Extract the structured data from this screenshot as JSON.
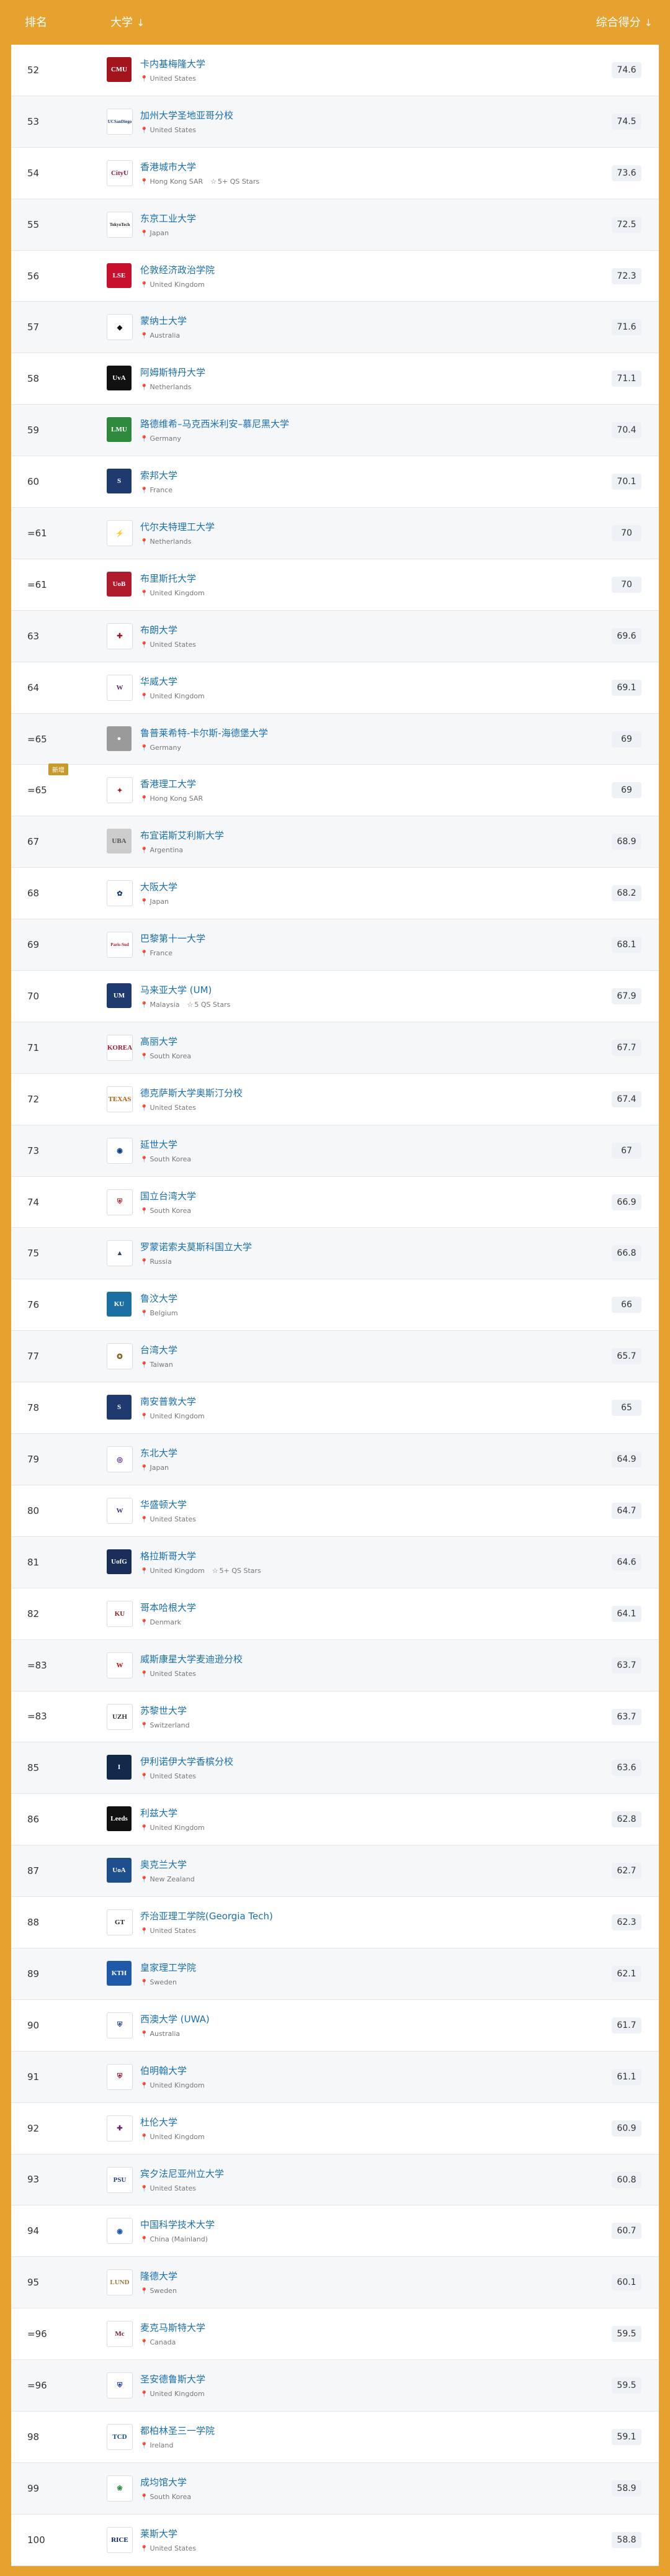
{
  "header": {
    "rank_label": "排名",
    "uni_label": "大学",
    "score_label": "综合得分",
    "sort_icon": "↓"
  },
  "icons": {
    "pin": "location-pin-icon",
    "star": "star-outline-icon",
    "sort": "sort-down-arrow-icon"
  },
  "rows": [
    {
      "rank": "52",
      "name": "卡内基梅隆大学",
      "country": "United States",
      "score": "74.6",
      "logo_color": "#a3141c",
      "logo_text": "CMU"
    },
    {
      "rank": "53",
      "name": "加州大学圣地亚哥分校",
      "country": "United States",
      "score": "74.5",
      "logo_color": "#ffffff",
      "logo_text": "UCSanDiego",
      "logo_fg": "#1a3a6b"
    },
    {
      "rank": "54",
      "name": "香港城市大学",
      "country": "Hong Kong SAR",
      "score": "73.6",
      "logo_color": "#ffffff",
      "logo_text": "CityU",
      "logo_fg": "#8a1c3c",
      "qs": "5+ QS Stars"
    },
    {
      "rank": "55",
      "name": "东京工业大学",
      "country": "Japan",
      "score": "72.5",
      "logo_color": "#ffffff",
      "logo_text": "TokyoTech",
      "logo_fg": "#222"
    },
    {
      "rank": "56",
      "name": "伦敦经济政治学院",
      "country": "United Kingdom",
      "score": "72.3",
      "logo_color": "#c8102e",
      "logo_text": "LSE"
    },
    {
      "rank": "57",
      "name": "蒙纳士大学",
      "country": "Australia",
      "score": "71.6",
      "logo_color": "#ffffff",
      "logo_text": "◆",
      "logo_fg": "#111"
    },
    {
      "rank": "58",
      "name": "阿姆斯特丹大学",
      "country": "Netherlands",
      "score": "71.1",
      "logo_color": "#111111",
      "logo_text": "UvA"
    },
    {
      "rank": "59",
      "name": "路德维希–马克西米利安–慕尼黑大学",
      "country": "Germany",
      "score": "70.4",
      "logo_color": "#2f8a3e",
      "logo_text": "LMU"
    },
    {
      "rank": "60",
      "name": "索邦大学",
      "country": "France",
      "score": "70.1",
      "logo_color": "#1f3a6e",
      "logo_text": "S"
    },
    {
      "rank": "=61",
      "name": "代尔夫特理工大学",
      "country": "Netherlands",
      "score": "70",
      "logo_color": "#ffffff",
      "logo_text": "⚡",
      "logo_fg": "#00a6d6"
    },
    {
      "rank": "=61",
      "name": "布里斯托大学",
      "country": "United Kingdom",
      "score": "70",
      "logo_color": "#b01c2e",
      "logo_text": "UoB"
    },
    {
      "rank": "63",
      "name": "布朗大学",
      "country": "United States",
      "score": "69.6",
      "logo_color": "#ffffff",
      "logo_text": "✚",
      "logo_fg": "#8c1b2b"
    },
    {
      "rank": "64",
      "name": "华威大学",
      "country": "United Kingdom",
      "score": "69.1",
      "logo_color": "#ffffff",
      "logo_text": "W",
      "logo_fg": "#5b2a6e"
    },
    {
      "rank": "=65",
      "name": "鲁普莱希特-卡尔斯-海德堡大学",
      "country": "Germany",
      "score": "69",
      "logo_color": "#9a9a9a",
      "logo_text": "●"
    },
    {
      "rank": "=65",
      "name": "香港理工大学",
      "country": "Hong Kong SAR",
      "score": "69",
      "logo_color": "#ffffff",
      "logo_text": "✦",
      "logo_fg": "#a3162b",
      "badge": "新增"
    },
    {
      "rank": "67",
      "name": "布宜诺斯艾利斯大学",
      "country": "Argentina",
      "score": "68.9",
      "logo_color": "#cccccc",
      "logo_text": "UBA",
      "logo_fg": "#555"
    },
    {
      "rank": "68",
      "name": "大阪大学",
      "country": "Japan",
      "score": "68.2",
      "logo_color": "#ffffff",
      "logo_text": "✿",
      "logo_fg": "#1a3a6b"
    },
    {
      "rank": "69",
      "name": "巴黎第十一大学",
      "country": "France",
      "score": "68.1",
      "logo_color": "#ffffff",
      "logo_text": "Paris-Sud",
      "logo_fg": "#9e1b32"
    },
    {
      "rank": "70",
      "name": "马来亚大学 (UM)",
      "country": "Malaysia",
      "score": "67.9",
      "logo_color": "#1f3a6e",
      "logo_text": "UM",
      "qs": "5 QS Stars"
    },
    {
      "rank": "71",
      "name": "高丽大学",
      "country": "South Korea",
      "score": "67.7",
      "logo_color": "#ffffff",
      "logo_text": "KOREA",
      "logo_fg": "#a11d33"
    },
    {
      "rank": "72",
      "name": "德克萨斯大学奥斯汀分校",
      "country": "United States",
      "score": "67.4",
      "logo_color": "#ffffff",
      "logo_text": "TEXAS",
      "logo_fg": "#bf5700"
    },
    {
      "rank": "73",
      "name": "延世大学",
      "country": "South Korea",
      "score": "67",
      "logo_color": "#ffffff",
      "logo_text": "◉",
      "logo_fg": "#0b3a7e"
    },
    {
      "rank": "74",
      "name": "国立台湾大学",
      "country": "South Korea",
      "score": "66.9",
      "logo_color": "#ffffff",
      "logo_text": "⛨",
      "logo_fg": "#b0202c"
    },
    {
      "rank": "75",
      "name": "罗蒙诺索夫莫斯科国立大学",
      "country": "Russia",
      "score": "66.8",
      "logo_color": "#ffffff",
      "logo_text": "▲",
      "logo_fg": "#33406e"
    },
    {
      "rank": "76",
      "name": "鲁汶大学",
      "country": "Belgium",
      "score": "66",
      "logo_color": "#1c6fa3",
      "logo_text": "KU"
    },
    {
      "rank": "77",
      "name": "台湾大学",
      "country": "Taiwan",
      "score": "65.7",
      "logo_color": "#ffffff",
      "logo_text": "✪",
      "logo_fg": "#7a5a1a"
    },
    {
      "rank": "78",
      "name": "南安普敦大学",
      "country": "United Kingdom",
      "score": "65",
      "logo_color": "#1f3a6e",
      "logo_text": "S"
    },
    {
      "rank": "79",
      "name": "东北大学",
      "country": "Japan",
      "score": "64.9",
      "logo_color": "#ffffff",
      "logo_text": "◎",
      "logo_fg": "#5a2a8a"
    },
    {
      "rank": "80",
      "name": "华盛顿大学",
      "country": "United States",
      "score": "64.7",
      "logo_color": "#ffffff",
      "logo_text": "W",
      "logo_fg": "#4b2e83"
    },
    {
      "rank": "81",
      "name": "格拉斯哥大学",
      "country": "United Kingdom",
      "score": "64.6",
      "logo_color": "#1a2e5a",
      "logo_text": "UofG",
      "qs": "5+ QS Stars"
    },
    {
      "rank": "82",
      "name": "哥本哈根大学",
      "country": "Denmark",
      "score": "64.1",
      "logo_color": "#ffffff",
      "logo_text": "KU",
      "logo_fg": "#901a1e"
    },
    {
      "rank": "=83",
      "name": "威斯康星大学麦迪逊分校",
      "country": "United States",
      "score": "63.7",
      "logo_color": "#ffffff",
      "logo_text": "W",
      "logo_fg": "#c5050c"
    },
    {
      "rank": "=83",
      "name": "苏黎世大学",
      "country": "Switzerland",
      "score": "63.7",
      "logo_color": "#ffffff",
      "logo_text": "UZH",
      "logo_fg": "#333"
    },
    {
      "rank": "85",
      "name": "伊利诺伊大学香槟分校",
      "country": "United States",
      "score": "63.6",
      "logo_color": "#13294b",
      "logo_text": "I"
    },
    {
      "rank": "86",
      "name": "利兹大学",
      "country": "United Kingdom",
      "score": "62.8",
      "logo_color": "#111111",
      "logo_text": "Leeds"
    },
    {
      "rank": "87",
      "name": "奥克兰大学",
      "country": "New Zealand",
      "score": "62.7",
      "logo_color": "#1f4e8c",
      "logo_text": "UoA"
    },
    {
      "rank": "88",
      "name": "乔治亚理工学院(Georgia Tech)",
      "country": "United States",
      "score": "62.3",
      "logo_color": "#ffffff",
      "logo_text": "GT",
      "logo_fg": "#222"
    },
    {
      "rank": "89",
      "name": "皇家理工学院",
      "country": "Sweden",
      "score": "62.1",
      "logo_color": "#1f5aa8",
      "logo_text": "KTH"
    },
    {
      "rank": "90",
      "name": "西澳大学 (UWA)",
      "country": "Australia",
      "score": "61.7",
      "logo_color": "#ffffff",
      "logo_text": "⛨",
      "logo_fg": "#27408b"
    },
    {
      "rank": "91",
      "name": "伯明翰大学",
      "country": "United Kingdom",
      "score": "61.1",
      "logo_color": "#ffffff",
      "logo_text": "⛨",
      "logo_fg": "#8a1a2e"
    },
    {
      "rank": "92",
      "name": "杜伦大学",
      "country": "United Kingdom",
      "score": "60.9",
      "logo_color": "#ffffff",
      "logo_text": "✚",
      "logo_fg": "#68246d"
    },
    {
      "rank": "93",
      "name": "宾夕法尼亚州立大学",
      "country": "United States",
      "score": "60.8",
      "logo_color": "#ffffff",
      "logo_text": "PSU",
      "logo_fg": "#1e407c"
    },
    {
      "rank": "94",
      "name": "中国科学技术大学",
      "country": "China (Mainland)",
      "score": "60.7",
      "logo_color": "#ffffff",
      "logo_text": "◉",
      "logo_fg": "#1c5aa8"
    },
    {
      "rank": "95",
      "name": "隆德大学",
      "country": "Sweden",
      "score": "60.1",
      "logo_color": "#ffffff",
      "logo_text": "LUND",
      "logo_fg": "#9a7a3a"
    },
    {
      "rank": "=96",
      "name": "麦克马斯特大学",
      "country": "Canada",
      "score": "59.5",
      "logo_color": "#ffffff",
      "logo_text": "Mc",
      "logo_fg": "#7a1c34"
    },
    {
      "rank": "=96",
      "name": "圣安德鲁斯大学",
      "country": "United Kingdom",
      "score": "59.5",
      "logo_color": "#ffffff",
      "logo_text": "⛨",
      "logo_fg": "#1f3a8a"
    },
    {
      "rank": "98",
      "name": "都柏林圣三一学院",
      "country": "Ireland",
      "score": "59.1",
      "logo_color": "#ffffff",
      "logo_text": "TCD",
      "logo_fg": "#0a4a8a"
    },
    {
      "rank": "99",
      "name": "成均馆大学",
      "country": "South Korea",
      "score": "58.9",
      "logo_color": "#ffffff",
      "logo_text": "❀",
      "logo_fg": "#2f8a3e"
    },
    {
      "rank": "100",
      "name": "莱斯大学",
      "country": "United States",
      "score": "58.8",
      "logo_color": "#ffffff",
      "logo_text": "RICE",
      "logo_fg": "#00205b"
    }
  ]
}
